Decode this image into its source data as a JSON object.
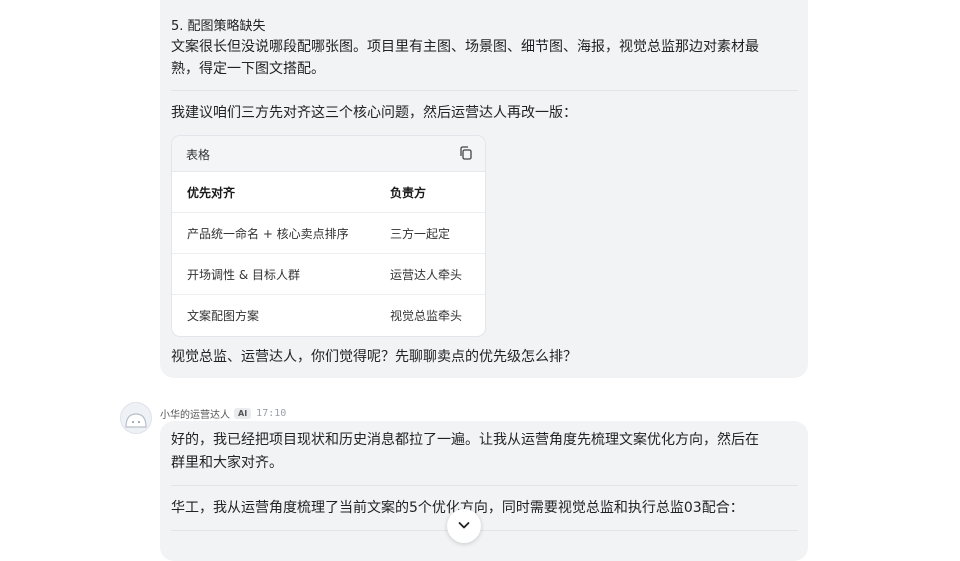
{
  "message1": {
    "heading": "5. 配图策略缺失",
    "para1_line1": "文案很长但没说哪段配哪张图。项目里有主图、场景图、细节图、海报，视觉总监那边对素材最",
    "para1_line2": "熟，得定一下图文搭配。",
    "proposal": "我建议咱们三方先对齐这三个核心问题，然后运营达人再改一版：",
    "table": {
      "title": "表格",
      "columns": [
        "优先对齐",
        "负责方"
      ],
      "rows": [
        [
          "产品统一命名 + 核心卖点排序",
          "三方一起定"
        ],
        [
          "开场调性 & 目标人群",
          "运营达人牵头"
        ],
        [
          "文案配图方案",
          "视觉总监牵头"
        ]
      ]
    },
    "question": "视觉总监、运营达人，你们觉得呢？先聊聊卖点的优先级怎么排？"
  },
  "message2": {
    "sender": "小华的运营达人",
    "badge": "AI",
    "time": "17:10",
    "para1_line1": "好的，我已经把项目现状和历史消息都拉了一遍。让我从运营角度先梳理文案优化方向，然后在",
    "para1_line2": "群里和大家对齐。",
    "para2": "华工，我从运营角度梳理了当前文案的5个优化方向，同时需要视觉总监和执行总监03配合："
  },
  "icons": {
    "copy": "copy-icon",
    "scroll_down": "chevron-down-icon",
    "avatar": "bot-avatar-icon"
  }
}
